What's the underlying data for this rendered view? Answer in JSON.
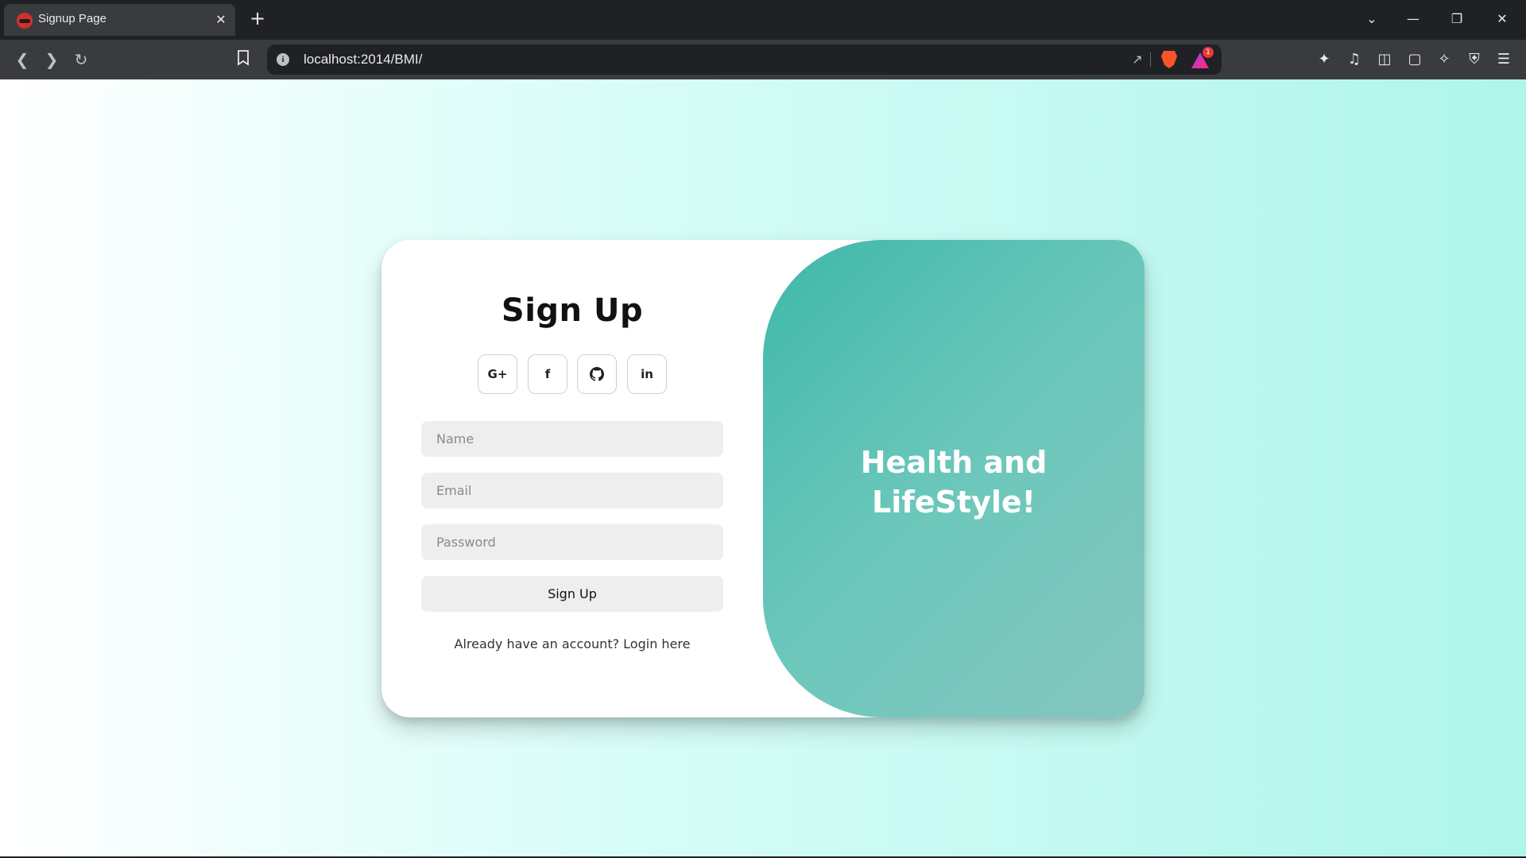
{
  "browser": {
    "tab_title": "Signup Page",
    "tab_close": "✕",
    "new_tab": "+",
    "url": "localhost:2014/BMI/",
    "rewards_count": "1",
    "window_controls": {
      "dropdown": "⌄",
      "minimize": "—",
      "restore": "❐",
      "close": "✕"
    }
  },
  "signup": {
    "title": "Sign Up",
    "social": [
      {
        "label": "G+",
        "icon": "google-plus-icon"
      },
      {
        "label": "f",
        "icon": "facebook-icon"
      },
      {
        "label": "",
        "icon": "github-icon"
      },
      {
        "label": "in",
        "icon": "linkedin-icon"
      }
    ],
    "fields": {
      "name_placeholder": "Name",
      "email_placeholder": "Email",
      "password_placeholder": "Password"
    },
    "submit_label": "Sign Up",
    "login_prompt": "Already have an account? Login here"
  },
  "hero": {
    "line1": "Health and",
    "line2": "LifeStyle!"
  },
  "colors": {
    "accent_teal": "#3fb8aa",
    "page_bg_end": "#aff5ea"
  }
}
